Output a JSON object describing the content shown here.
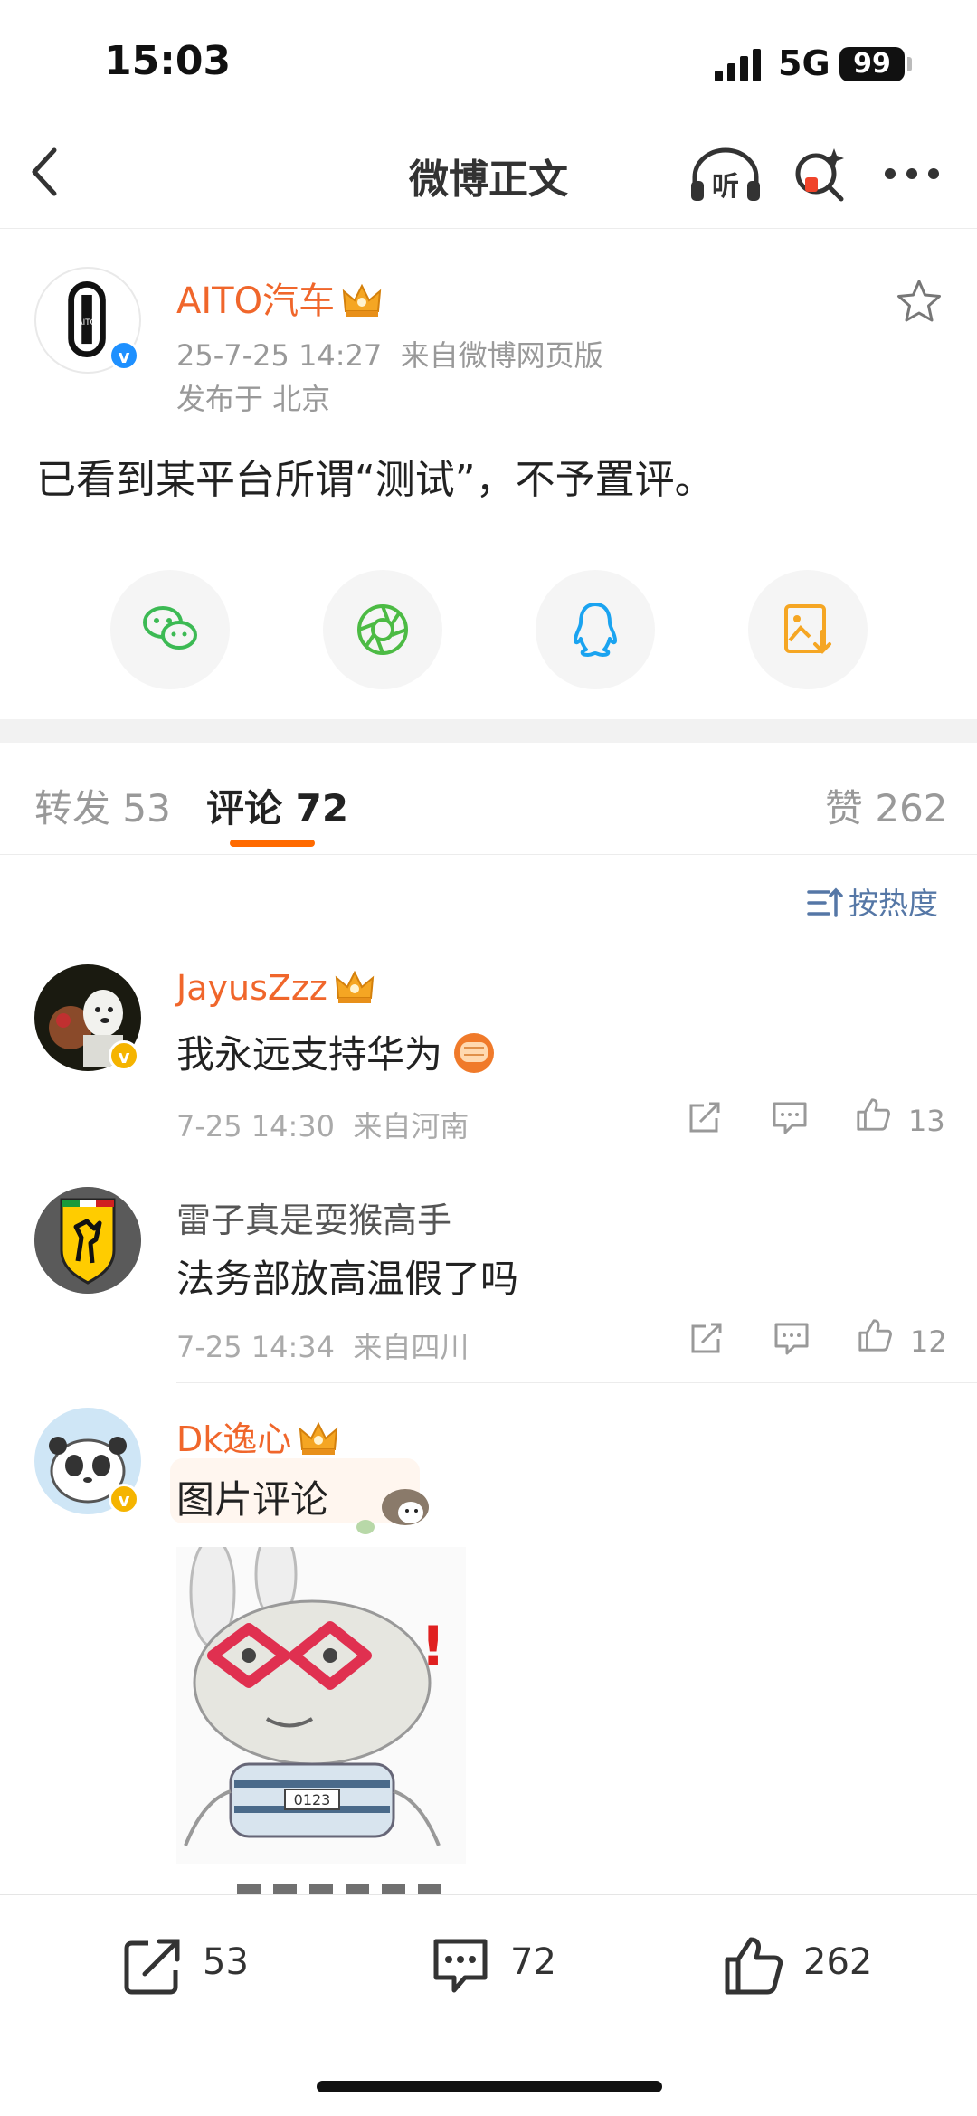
{
  "status": {
    "time": "15:03",
    "network": "5G",
    "battery": "99"
  },
  "header": {
    "title": "微博正文",
    "listen_label": "听"
  },
  "post": {
    "author": "AITO汽车",
    "timestamp": "25-7-25 14:27",
    "source": "来自微博网页版",
    "location": "发布于 北京",
    "text": "已看到某平台所谓“测试”，不予置评。",
    "logo_text": "AITO"
  },
  "share": [
    "wechat-icon",
    "moments-icon",
    "qq-icon",
    "save-image-icon"
  ],
  "tabs": {
    "repost": "转发 53",
    "comments": "评论 72",
    "likes": "赞 262"
  },
  "sort_label": "按热度",
  "comments": [
    {
      "name": "JayusZzz",
      "text": "我永远支持华为",
      "time": "7-25 14:30",
      "location": "来自河南",
      "likes": "13"
    },
    {
      "name": "雷子真是耍猴高手",
      "text": "法务部放高温假了吗",
      "time": "7-25 14:34",
      "location": "来自四川",
      "likes": "12"
    },
    {
      "name": "Dk逸心",
      "text": "图片评论",
      "meme_label": "0123"
    }
  ],
  "bottom_bar": {
    "reposts": "53",
    "comments": "72",
    "likes": "262"
  },
  "colors": {
    "accent": "#f0662b",
    "tab_underline": "#ff6a00",
    "link": "#5577a6"
  }
}
